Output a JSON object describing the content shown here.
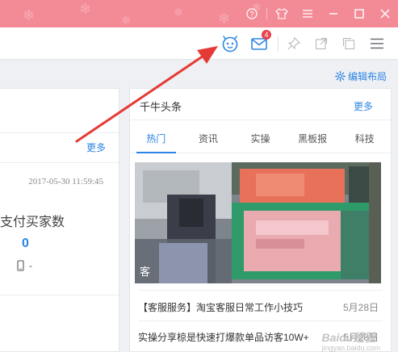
{
  "toolbar": {
    "mail_badge": "4"
  },
  "edit_layout": {
    "label": "编辑布局"
  },
  "left_panel": {
    "more": "更多",
    "timestamp": "2017-05-30 11:59:45",
    "metric_label": "支付买家数",
    "metric_value": "0",
    "device_value": "-"
  },
  "right_panel": {
    "title": "千牛头条",
    "more": "更多",
    "tabs": [
      {
        "label": "热门",
        "active": true
      },
      {
        "label": "资讯",
        "active": false
      },
      {
        "label": "实操",
        "active": false
      },
      {
        "label": "黑板报",
        "active": false
      },
      {
        "label": "科技",
        "active": false
      }
    ],
    "banner_caption": "客",
    "news": [
      {
        "title": "【客服服务】淘宝客服日常工作小技巧",
        "date": "5月28日"
      },
      {
        "title": "实操分享椋是快速打爆款单品访客10W+",
        "date": "5月28日"
      }
    ]
  },
  "watermark": {
    "text": "Baidu经验",
    "sub": "jingyan.baidu.com"
  },
  "colors": {
    "title_bar": "#f38b97",
    "accent": "#2b85e4",
    "badge": "#e8414b",
    "arrow": "#e53935"
  }
}
